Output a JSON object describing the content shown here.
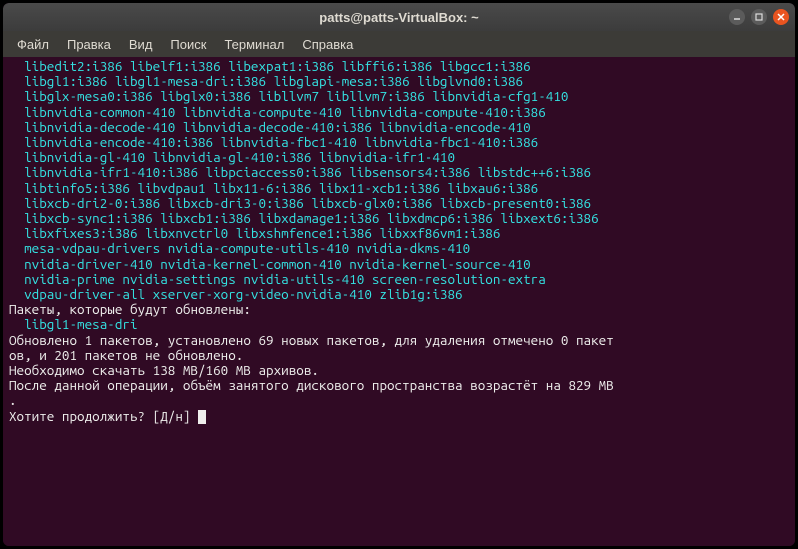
{
  "title": "patts@patts-VirtualBox: ~",
  "menu": {
    "file": "Файл",
    "edit": "Правка",
    "view": "Вид",
    "search": "Поиск",
    "terminal": "Терминал",
    "help": "Справка"
  },
  "pkg_lines": [
    "  libedit2:i386 libelf1:i386 libexpat1:i386 libffi6:i386 libgcc1:i386",
    "  libgl1:i386 libgl1-mesa-dri:i386 libglapi-mesa:i386 libglvnd0:i386",
    "  libglx-mesa0:i386 libglx0:i386 libllvm7 libllvm7:i386 libnvidia-cfg1-410",
    "  libnvidia-common-410 libnvidia-compute-410 libnvidia-compute-410:i386",
    "  libnvidia-decode-410 libnvidia-decode-410:i386 libnvidia-encode-410",
    "  libnvidia-encode-410:i386 libnvidia-fbc1-410 libnvidia-fbc1-410:i386",
    "  libnvidia-gl-410 libnvidia-gl-410:i386 libnvidia-ifr1-410",
    "  libnvidia-ifr1-410:i386 libpciaccess0:i386 libsensors4:i386 libstdc++6:i386",
    "  libtinfo5:i386 libvdpau1 libx11-6:i386 libx11-xcb1:i386 libxau6:i386",
    "  libxcb-dri2-0:i386 libxcb-dri3-0:i386 libxcb-glx0:i386 libxcb-present0:i386",
    "  libxcb-sync1:i386 libxcb1:i386 libxdamage1:i386 libxdmcp6:i386 libxext6:i386",
    "  libxfixes3:i386 libxnvctrl0 libxshmfence1:i386 libxxf86vm1:i386",
    "  mesa-vdpau-drivers nvidia-compute-utils-410 nvidia-dkms-410",
    "  nvidia-driver-410 nvidia-kernel-common-410 nvidia-kernel-source-410",
    "  nvidia-prime nvidia-settings nvidia-utils-410 screen-resolution-extra",
    "  vdpau-driver-all xserver-xorg-video-nvidia-410 zlib1g:i386"
  ],
  "update_header": "Пакеты, которые будут обновлены:",
  "update_pkg": "  libgl1-mesa-dri",
  "summary1": "Обновлено 1 пакетов, установлено 69 новых пакетов, для удаления отмечено 0 пакет",
  "summary2": "ов, и 201 пакетов не обновлено.",
  "download": "Необходимо скачать 138 MB/160 MB архивов.",
  "disk1": "После данной операции, объём занятого дискового пространства возрастёт на 829 MB",
  "disk2": ".",
  "prompt": "Хотите продолжить? [Д/н] "
}
